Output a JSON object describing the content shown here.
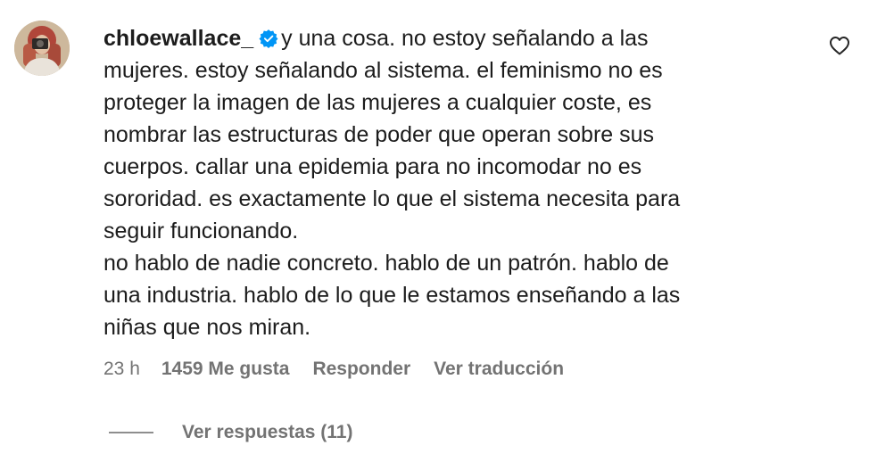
{
  "comment": {
    "username": "chloewallace_",
    "verified": true,
    "text_lines": [
      "y una cosa. no estoy señalando a las",
      "mujeres. estoy señalando al sistema. el feminismo no es",
      "proteger la imagen de las mujeres a cualquier coste, es",
      "nombrar las estructuras de poder que operan sobre sus",
      "cuerpos. callar una epidemia para no incomodar no es",
      "sororidad. es exactamente lo que el sistema necesita para",
      "seguir funcionando.",
      "no hablo de nadie concreto. hablo de un patrón. hablo de",
      "una industria. hablo de lo que le estamos enseñando a las",
      "niñas que nos miran."
    ],
    "time": "23 h",
    "likes": "1459 Me gusta",
    "reply_label": "Responder",
    "translate_label": "Ver traducción",
    "view_replies_label": "Ver respuestas (11)"
  },
  "icons": {
    "verified": "verified-badge-icon",
    "like": "heart-icon"
  },
  "colors": {
    "verified_blue": "#0095f6",
    "text": "#1c1c1c",
    "secondary": "#737373"
  }
}
